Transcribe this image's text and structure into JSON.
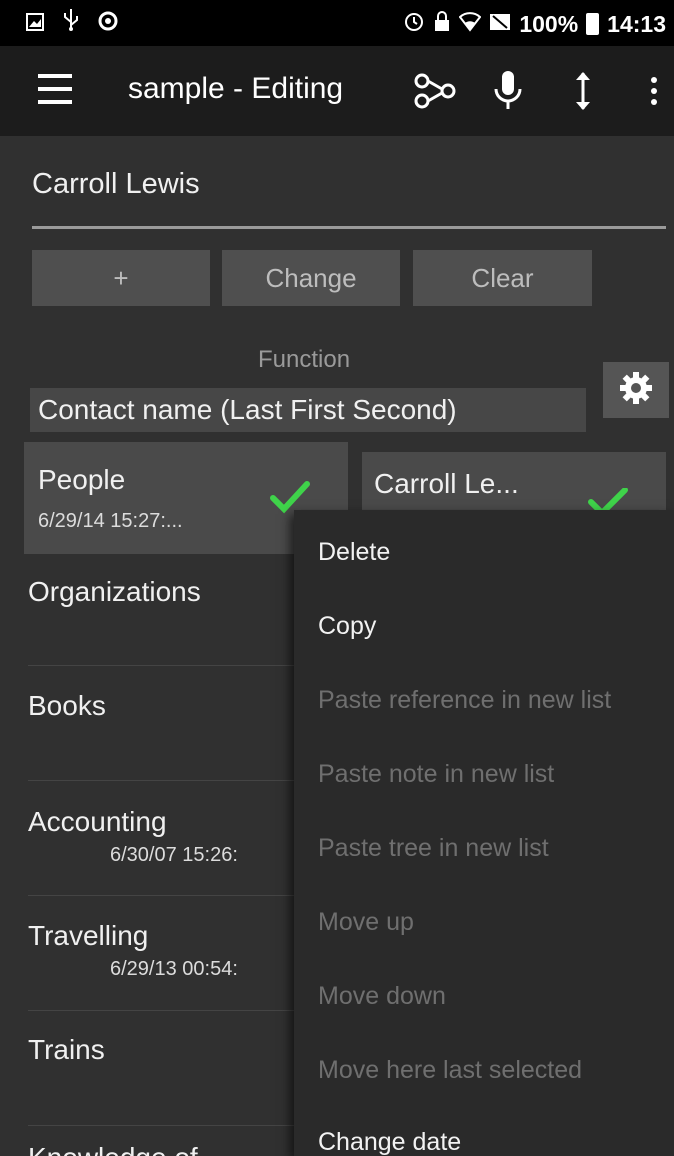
{
  "status_bar": {
    "left_icons": [
      "image-icon",
      "usb-icon",
      "record-icon"
    ],
    "right_icons": [
      "alarm-icon",
      "lock-icon",
      "wifi-icon",
      "no-signal-icon",
      "battery-icon"
    ],
    "battery": "100%",
    "time": "14:13"
  },
  "app_bar": {
    "title": "sample - Editing",
    "actions": [
      "tree-icon",
      "microphone-icon",
      "reorder-icon",
      "overflow-icon"
    ]
  },
  "editor": {
    "name_value": "Carroll Lewis",
    "buttons": {
      "add": "+",
      "change": "Change",
      "clear": "Clear"
    },
    "function_label": "Function",
    "function_value": "Contact name (Last First Second)"
  },
  "list": {
    "people": {
      "title": "People",
      "date": "6/29/14 15:27:..."
    },
    "selected_entry": "Carroll Le...",
    "items": [
      {
        "title": "Organizations",
        "date": ""
      },
      {
        "title": "Books",
        "date": ""
      },
      {
        "title": "Accounting",
        "date": "6/30/07 15:26:"
      },
      {
        "title": "Travelling",
        "date": "6/29/13 00:54:"
      },
      {
        "title": "Trains",
        "date": ""
      },
      {
        "title": "Knowledge of ...",
        "date": ""
      }
    ]
  },
  "context_menu": {
    "items": [
      {
        "label": "Delete",
        "enabled": true
      },
      {
        "label": "Copy",
        "enabled": true
      },
      {
        "label": "Paste reference in new list",
        "enabled": false
      },
      {
        "label": "Paste note in new list",
        "enabled": false
      },
      {
        "label": "Paste tree in new list",
        "enabled": false
      },
      {
        "label": "Move up",
        "enabled": false
      },
      {
        "label": "Move down",
        "enabled": false
      },
      {
        "label": "Move here last selected",
        "enabled": false
      },
      {
        "label": "Change date",
        "enabled": true
      }
    ]
  },
  "colors": {
    "background": "#303030",
    "app_bar": "#1c1c1c",
    "button": "#4f4f4f",
    "check_green": "#3fd34a",
    "menu_bg": "#2a2a2a",
    "menu_disabled": "#6f6f6f"
  }
}
